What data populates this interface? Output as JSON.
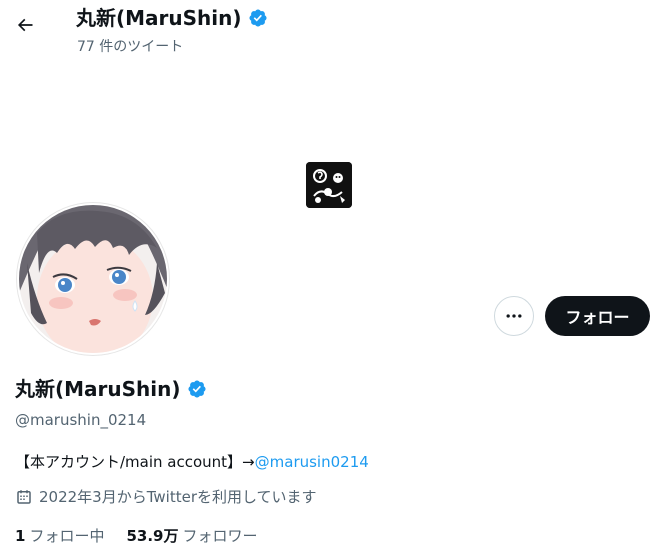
{
  "header": {
    "title": "丸新(MaruShin)",
    "tweet_count": "77 件のツイート"
  },
  "profile": {
    "name": "丸新(MaruShin)",
    "handle": "@marushin_0214",
    "bio_prefix": "【本アカウント/main account】→",
    "bio_link": "@marusin0214",
    "joined": "2022年3月からTwitterを利用しています"
  },
  "actions": {
    "follow_label": "フォロー"
  },
  "stats": {
    "following_count": "1",
    "following_label": "フォロー中",
    "followers_count": "53.9万",
    "followers_label": "フォロワー"
  },
  "colors": {
    "verified_blue": "#1d9bf0",
    "link_blue": "#1d9bf0",
    "text_primary": "#0f1419",
    "text_secondary": "#536471",
    "button_dark": "#0f1419"
  },
  "icons": {
    "back": "back-arrow-icon",
    "verified": "verified-badge-icon",
    "more": "more-dots-icon",
    "calendar": "calendar-icon"
  }
}
